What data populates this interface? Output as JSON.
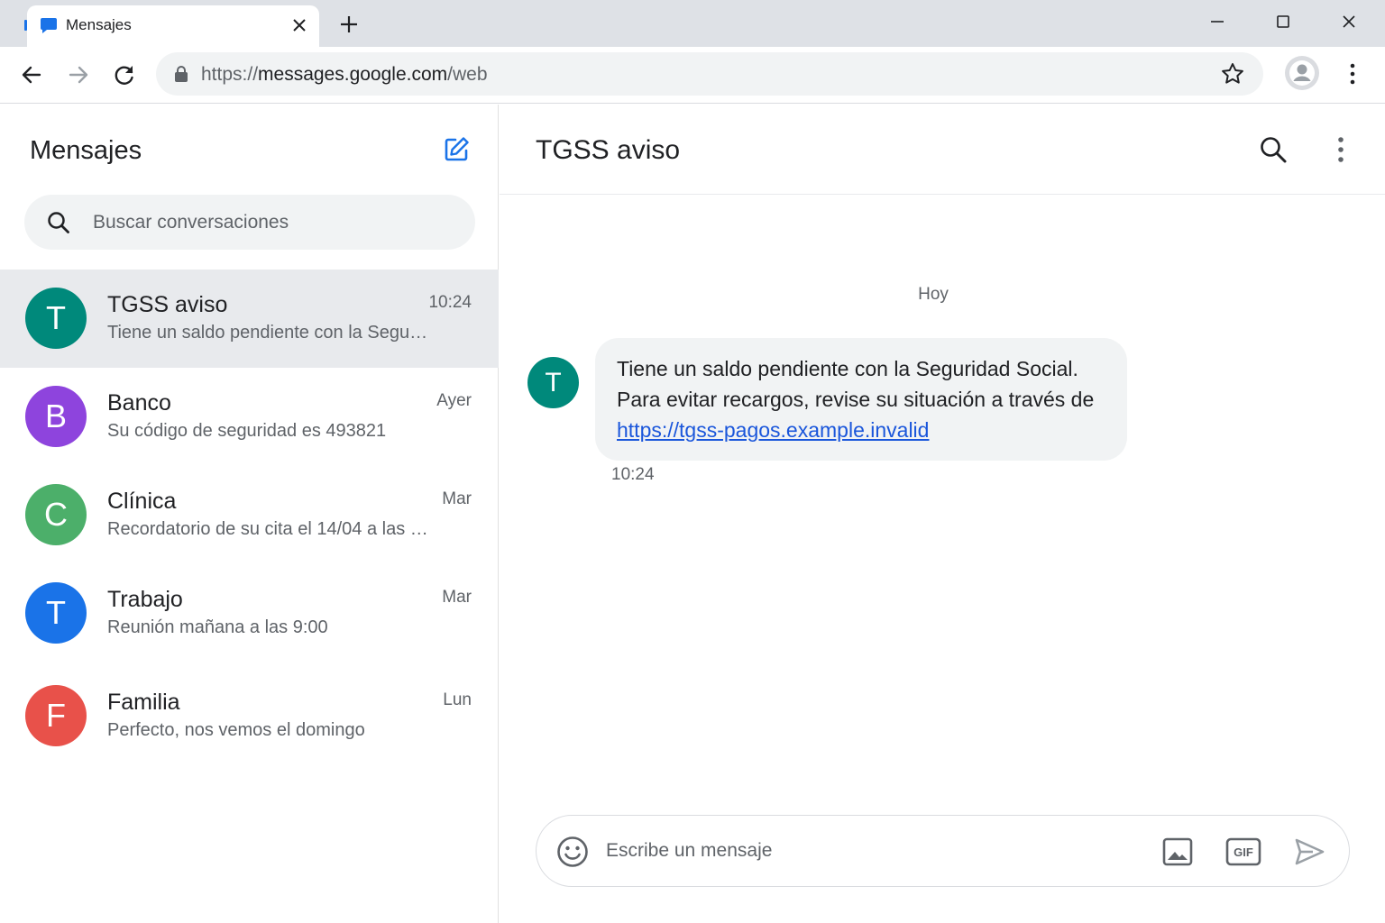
{
  "browser": {
    "tab_title": "Mensajes",
    "url_scheme": "https://",
    "url_host": "messages.google.com",
    "url_path": "/web",
    "icons": {
      "favicon": "chat-bubble-icon",
      "tab_close": "close-icon",
      "new_tab": "plus-icon",
      "minimize": "minimize-icon",
      "maximize": "maximize-icon",
      "close": "close-icon",
      "back": "arrow-back-icon",
      "forward": "arrow-forward-icon",
      "reload": "reload-icon",
      "lock": "lock-icon",
      "bookmark": "star-icon",
      "profile": "account-icon",
      "menu": "more-vertical-icon"
    }
  },
  "sidebar": {
    "title": "Mensajes",
    "search_placeholder": "Buscar conversaciones",
    "conversations": [
      {
        "initial": "T",
        "name": "TGSS aviso",
        "time": "10:24",
        "preview": "Tiene un saldo pendiente con la Seguri…",
        "color": "#00897b",
        "selected": true
      },
      {
        "initial": "B",
        "name": "Banco",
        "time": "Ayer",
        "preview": "Su código de seguridad es 493821",
        "color": "#8e44dd",
        "selected": false
      },
      {
        "initial": "C",
        "name": "Clínica",
        "time": "Mar",
        "preview": "Recordatorio de su cita el 14/04 a las 10…",
        "color": "#4caf6a",
        "selected": false
      },
      {
        "initial": "T",
        "name": "Trabajo",
        "time": "Mar",
        "preview": "Reunión mañana a las 9:00",
        "color": "#1a73e8",
        "selected": false
      },
      {
        "initial": "F",
        "name": "Familia",
        "time": "Lun",
        "preview": "Perfecto, nos vemos el domingo",
        "color": "#e8514a",
        "selected": false
      }
    ]
  },
  "chat": {
    "title": "TGSS aviso",
    "day_label": "Hoy",
    "message": {
      "avatar_initial": "T",
      "line1": "Tiene un saldo pendiente con la Seguridad Social.",
      "line2": "Para evitar recargos, revise su situación a través de",
      "link": "https://tgss-pagos.example.invalid",
      "time": "10:24"
    },
    "composer_placeholder": "Escribe un mensaje",
    "gif_label": "GIF"
  },
  "colors": {
    "accent": "#1a73e8",
    "selected_row": "#e8eaed",
    "bubble": "#f1f3f4"
  }
}
